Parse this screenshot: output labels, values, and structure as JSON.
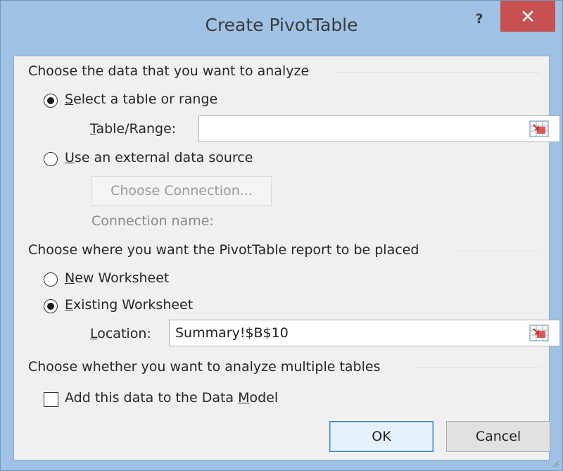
{
  "window": {
    "title": "Create PivotTable",
    "help_label": "?"
  },
  "section_data": {
    "label": "Choose the data that you want to analyze"
  },
  "radio_select_range": {
    "label_ul": "S",
    "label_rest": "elect a table or range",
    "selected": true
  },
  "table_range": {
    "label_ul": "T",
    "label_rest": "able/Range:",
    "value": ""
  },
  "radio_external": {
    "label_ul": "U",
    "label_rest": "se an external data source",
    "selected": false
  },
  "choose_connection": {
    "label": "Choose Connection..."
  },
  "connection_name": {
    "label": "Connection name:"
  },
  "section_place": {
    "label": "Choose where you want the PivotTable report to be placed"
  },
  "radio_new_ws": {
    "label_ul": "N",
    "label_rest": "ew Worksheet",
    "selected": false
  },
  "radio_existing_ws": {
    "label_ul": "E",
    "label_rest": "xisting Worksheet",
    "selected": true
  },
  "location": {
    "label_ul": "L",
    "label_rest": "ocation:",
    "value": "Summary!$B$10"
  },
  "section_multi": {
    "label": "Choose whether you want to analyze multiple tables"
  },
  "data_model": {
    "label_pre": "Add this data to the Data ",
    "label_ul": "M",
    "label_rest": "odel",
    "checked": false
  },
  "buttons": {
    "ok": "OK",
    "cancel": "Cancel"
  },
  "colors": {
    "title_bar": "#9fc2e4",
    "close_button": "#c75050",
    "client_bg": "#f0f0f0",
    "default_button_border": "#3c7fb1"
  }
}
